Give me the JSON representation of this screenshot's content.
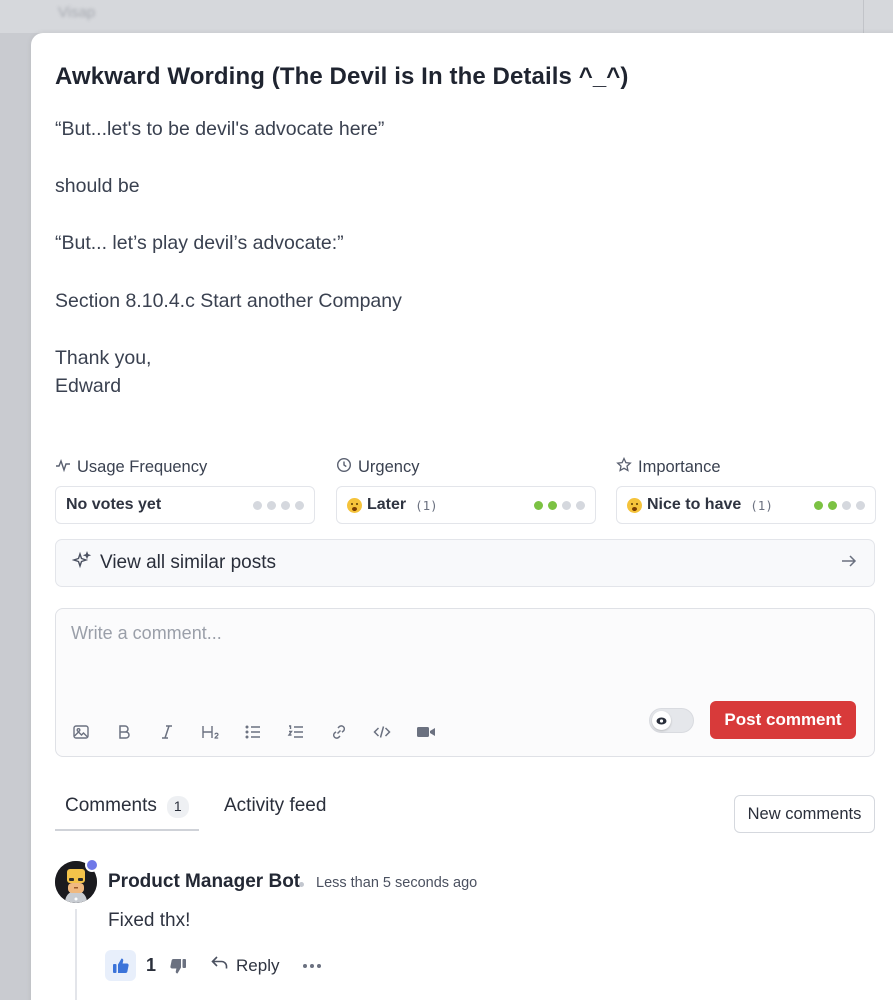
{
  "backdrop": {
    "blurred_text": "Visap"
  },
  "post": {
    "title": "Awkward Wording (The Devil is In the Details ^_^)",
    "body": {
      "line1": "“But...let's to be devil's advocate here”",
      "line2": "should be",
      "line3": "“But... let’s play devil’s advocate:”",
      "line4": "Section 8.10.4.c Start another Company",
      "line5": "Thank you,",
      "line6": "Edward"
    }
  },
  "metrics": [
    {
      "label": "Usage Frequency",
      "icon": "activity-icon",
      "value": "No votes yet",
      "count": "",
      "level": 0,
      "max": 4
    },
    {
      "label": "Urgency",
      "icon": "clock-icon",
      "value": "Later",
      "count": "(1)",
      "level": 2,
      "max": 4
    },
    {
      "label": "Importance",
      "icon": "star-icon",
      "value": "Nice to have",
      "count": "(1)",
      "level": 2,
      "max": 4
    }
  ],
  "similar": {
    "label": "View all similar posts"
  },
  "composer": {
    "placeholder": "Write a comment...",
    "post_label": "Post comment",
    "tools": [
      "image-icon",
      "bold-icon",
      "italic-icon",
      "heading-icon",
      "bullet-list-icon",
      "numbered-list-icon",
      "link-icon",
      "code-icon",
      "video-icon"
    ]
  },
  "tabs": {
    "comments_label": "Comments",
    "comments_count": "1",
    "activity_label": "Activity feed",
    "new_comments_label": "New comments"
  },
  "comment": {
    "author": "Product Manager Bot",
    "time": "Less than 5 seconds ago",
    "text": "Fixed thx!",
    "likes": "1",
    "reply_label": "Reply"
  },
  "colors": {
    "accent_red": "#d83a3a",
    "dot_active": "#7cc243",
    "dot_inactive": "#d5d8de",
    "like_blue": "#3b73d9"
  }
}
